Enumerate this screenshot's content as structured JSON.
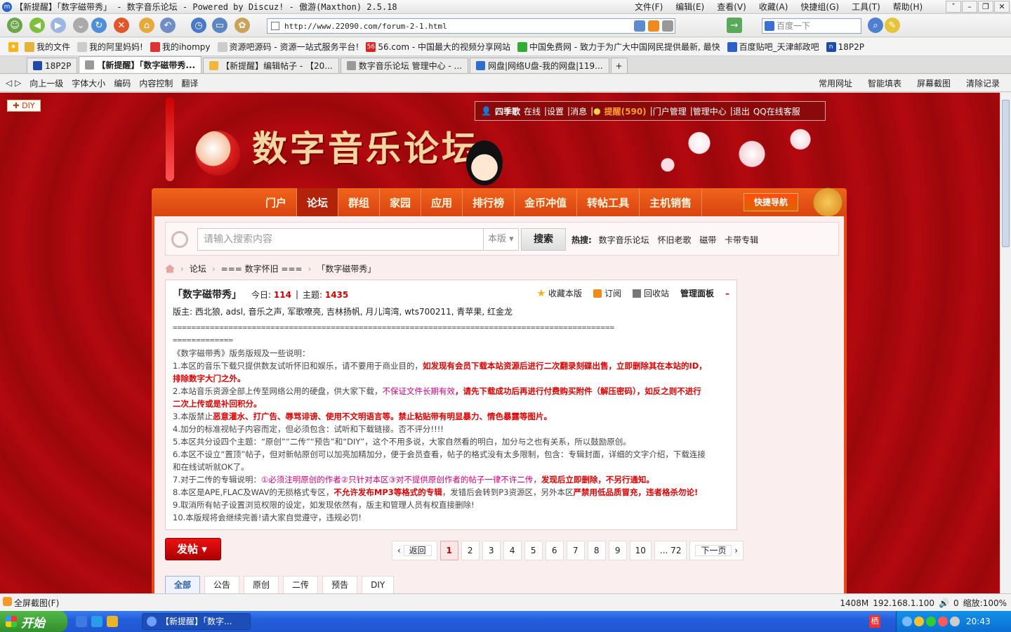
{
  "window": {
    "title": "【新提醒】「数字磁带秀」 - 数字音乐论坛 - Powered by Discuz! - 傲游(Maxthon) 2.5.18",
    "menu": [
      "文件(F)",
      "编辑(E)",
      "查看(V)",
      "收藏(A)",
      "快捷组(G)",
      "工具(T)",
      "帮助(H)"
    ]
  },
  "toolbar": {
    "address": "http://www.22090.com/forum-2-1.html",
    "search_placeholder": "百度一下"
  },
  "favorites": [
    "我的文件",
    "我的阿里妈妈!",
    "我的ihompy",
    "资源吧源码 - 资源一站式服务平台!",
    "56.com - 中国最大的视频分享网站",
    "中国免费网 - 致力于为广大中国网民提供最新, 最快",
    "百度贴吧_天津邮政吧",
    "18P2P"
  ],
  "tabs": [
    "18P2P",
    "【新提醒】「数字磁带秀...",
    "【新提醒】编辑帖子 - 【20...",
    "数字音乐论坛 管理中心 - ...",
    "网盘|网络U盘-我的网盘|119..."
  ],
  "navbar2": {
    "left": [
      "向上一级",
      "字体大小",
      "编码",
      "内容控制",
      "翻译"
    ],
    "right": [
      "常用网址",
      "智能填表",
      "屏幕截图",
      "清除记录"
    ]
  },
  "page": {
    "diy": "DIY",
    "logo": "数字音乐论坛",
    "userbar": {
      "user": "四季歌",
      "status": "在线",
      "links": [
        "设置",
        "消息"
      ],
      "warn": "提醒(590)",
      "links2": [
        "门户管理",
        "管理中心",
        "退出",
        "QQ在线客服"
      ]
    },
    "mainnav": [
      "门户",
      "论坛",
      "群组",
      "家园",
      "应用",
      "排行榜",
      "金币冲值",
      "转帖工具",
      "主机销售"
    ],
    "quicknav": "快捷导航",
    "search": {
      "placeholder": "请输入搜索内容",
      "scope": "本版",
      "button": "搜索",
      "hot_label": "热搜:",
      "hot": [
        "数字音乐论坛",
        "怀旧老歌",
        "磁带",
        "卡带专辑"
      ]
    },
    "breadcrumb": [
      "论坛",
      "=== 数字怀旧 ===",
      "「数字磁带秀」"
    ],
    "forum": {
      "title": "「数字磁带秀」",
      "today_label": "今日:",
      "today": "114",
      "topics_label": "主题:",
      "topics": "1435",
      "actions": [
        "收藏本版",
        "订阅",
        "回收站",
        "管理面板"
      ],
      "mods": "版主: 西北狼, adsl, 音乐之声, 军歌嘹亮, 吉林扬帆, 月儿湾湾, wts700211, 青苹果, 红金龙"
    },
    "rules": {
      "sep1": "===============================================================================================",
      "sep2": "=============",
      "intro": "《数字磁带秀》版务版规及一些说明：",
      "r1a": "1.本区的音乐下载只提供数友试听怀旧和娱乐，请不要用于商业目的，",
      "r1b": "如发现有会员下载本站资源后进行二次翻录刻碟出售，立即删除其在本站的ID，",
      "r1c": "排除数字大门之外。",
      "r2a": "2.本站音乐资源全部上传至网络公用的硬盘，供大家下载，",
      "r2b": "不保证文件长期有效",
      "r2c": "，请先下载成功后再进行付费购买附件（解压密码），如反之则不进行",
      "r2d": "二次上传或是补回积分。",
      "r3a": "3.本版禁止",
      "r3b": "恶意灌水、打广告、辱骂诽谤、使用不文明语言等。禁止粘贴带有明显暴力、情色暴露等图片。",
      "r4": "4.加分的标准视帖子内容而定，但必须包含：试听和下载链接。否不评分!!!!",
      "r5": "5.本区共分设四个主题：“原创”“二传”“预告”和“DIY”，这个不用多说，大家自然看的明白，加分与之也有关系，所以鼓励原创。",
      "r6a": "6.本区不设立“置顶”帖子，但对新帖原创可以加亮加精加分，便于会员查看，帖子的格式没有太多限制，包含：专辑封面，详细的文字介绍，下载连接",
      "r6b": "和在线试听就OK了。",
      "r7a": "7.对于二传的专辑说明：",
      "r7b": "①必须注明原创的作者②只针对本区③对不提供原创作者的帖子一律不许二传，",
      "r7c": "发现后立即删除，不另行通知。",
      "r8a": "8.本区是APE,FLAC及WAV的无损格式专区，",
      "r8b": "不允许发布MP3等格式的专辑",
      "r8c": "，发错后会转到P3资源区，另外本区",
      "r8d": "严禁用低品质冒充，违者格杀勿论!",
      "r9": "9.取消所有帖子设置浏览权限的设定，如发现依然有，版主和管理人员有权直接删除!",
      "r10": "10.本版规将会继续完善!请大家自觉遵守，违规必罚!"
    },
    "post_button": "发帖",
    "pager": [
      "返回",
      "1",
      "2",
      "3",
      "4",
      "5",
      "6",
      "7",
      "8",
      "9",
      "10",
      "... 72",
      "下一页"
    ],
    "thread_tabs": [
      "全部",
      "公告",
      "原创",
      "二传",
      "预告",
      "DIY"
    ]
  },
  "status": {
    "left": "全屏截图(F)",
    "right": [
      "1408M",
      "192.168.1.100",
      "0",
      "缩放:100%"
    ]
  },
  "taskbar": {
    "start": "开始",
    "task": "【新提醒】「数字...",
    "time": "20:43"
  }
}
